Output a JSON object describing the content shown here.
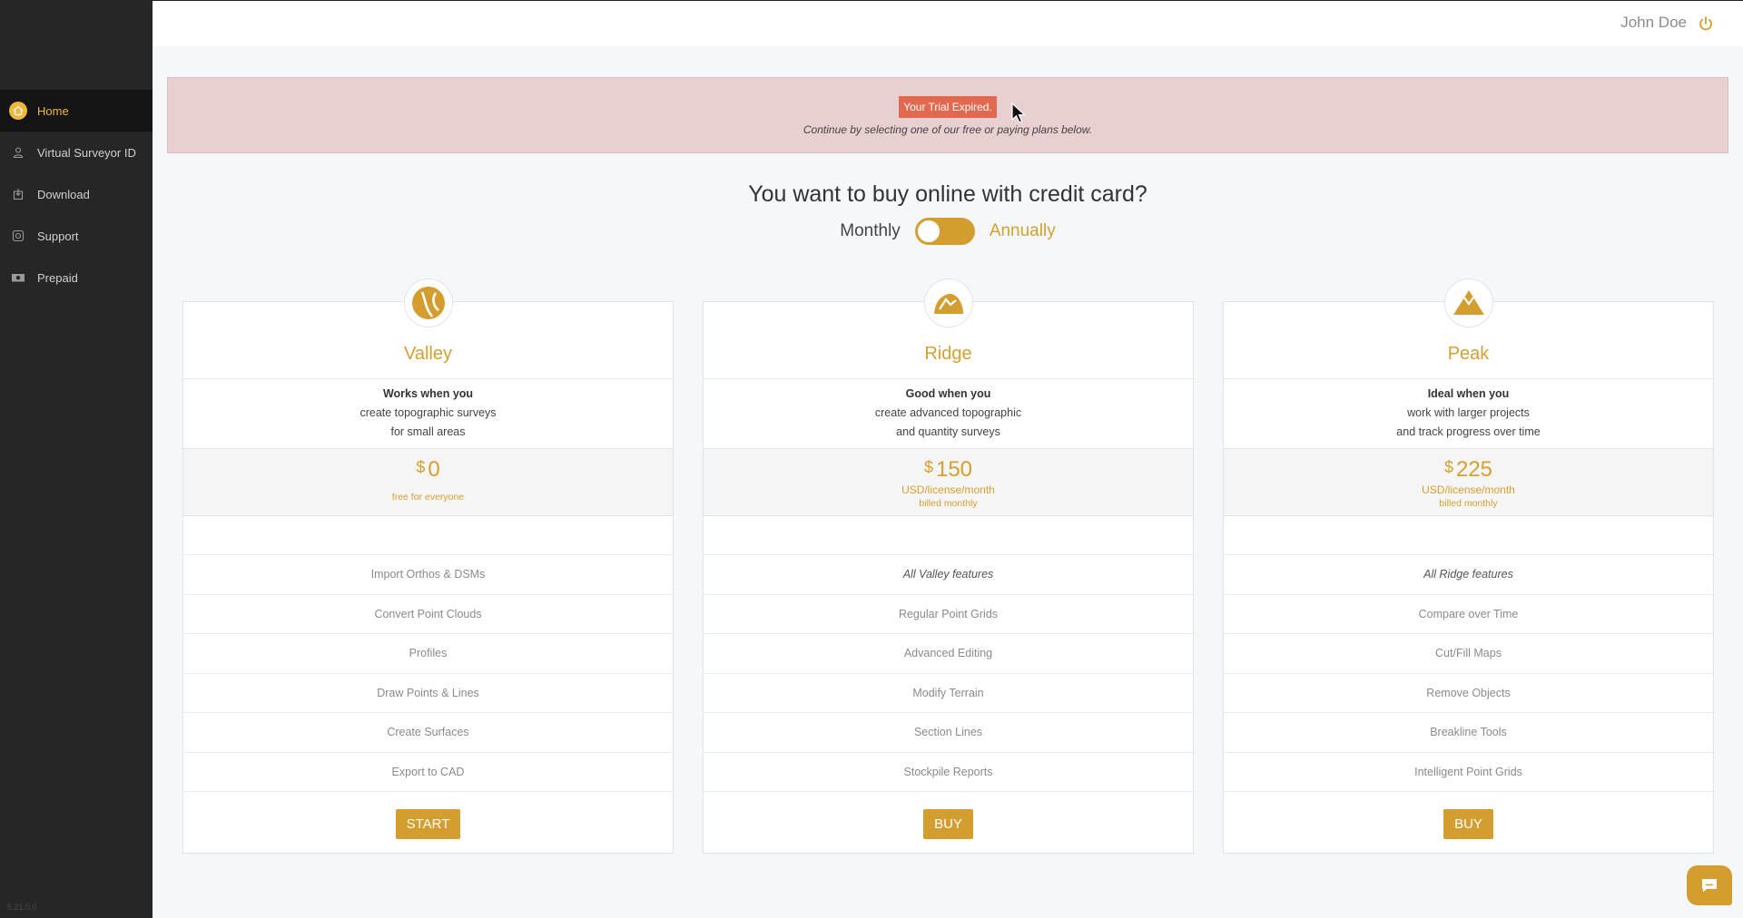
{
  "user": {
    "name": "John Doe"
  },
  "sidebar": {
    "items": [
      {
        "label": "Home",
        "icon": "home-icon"
      },
      {
        "label": "Virtual Surveyor ID",
        "icon": "person-icon"
      },
      {
        "label": "Download",
        "icon": "download-icon"
      },
      {
        "label": "Support",
        "icon": "support-icon"
      },
      {
        "label": "Prepaid",
        "icon": "money-icon"
      }
    ],
    "active": "Home",
    "version": "5.21.0.0"
  },
  "banner": {
    "badge": "Your Trial Expired.",
    "subtitle": "Continue by selecting one of our free or paying plans below."
  },
  "purchase": {
    "headline": "You want to buy online with credit card?",
    "toggle": {
      "left": "Monthly",
      "right": "Annually"
    }
  },
  "plans": [
    {
      "name": "Valley",
      "desc_lead": "Works when you",
      "desc_1": "create topographic surveys",
      "desc_2": "for small areas",
      "currency": "$",
      "price": "0",
      "unit": "",
      "note": "free for everyone",
      "features": [
        "Import Orthos & DSMs",
        "Convert Point Clouds",
        "Profiles",
        "Draw Points & Lines",
        "Create Surfaces",
        "Export to CAD"
      ],
      "cta": "START"
    },
    {
      "name": "Ridge",
      "desc_lead": "Good when you",
      "desc_1": "create advanced topographic",
      "desc_2": "and quantity surveys",
      "currency": "$",
      "price": "150",
      "unit": "USD/license/month",
      "note": "billed monthly",
      "features": [
        "All Valley features",
        "Regular Point Grids",
        "Advanced Editing",
        "Modify Terrain",
        "Section Lines",
        "Stockpile Reports"
      ],
      "cta": "BUY"
    },
    {
      "name": "Peak",
      "desc_lead": "Ideal when you",
      "desc_1": "work with larger projects",
      "desc_2": "and track progress over time",
      "currency": "$",
      "price": "225",
      "unit": "USD/license/month",
      "note": "billed monthly",
      "features": [
        "All Ridge features",
        "Compare over Time",
        "Cut/Fill Maps",
        "Remove Objects",
        "Breakline Tools",
        "Intelligent Point Grids"
      ],
      "cta": "BUY"
    }
  ],
  "colors": {
    "accent": "#d39e2f",
    "sidebar": "#262626",
    "banner": "#e8cfd0",
    "badge": "#e1694f"
  }
}
